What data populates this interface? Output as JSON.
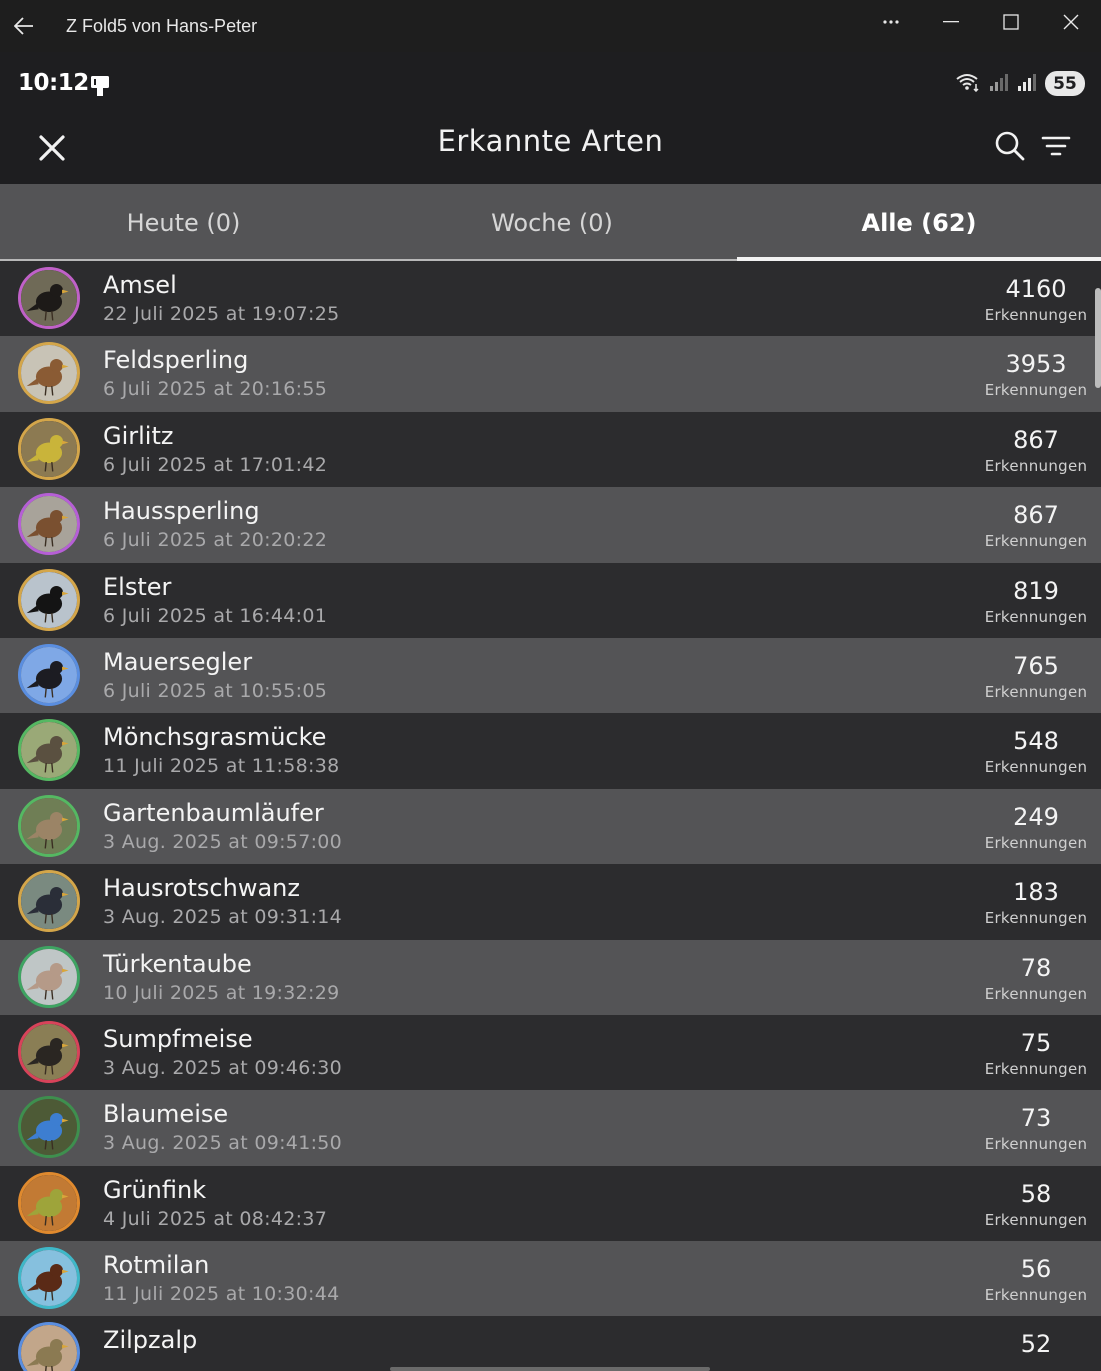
{
  "window": {
    "title": "Z Fold5 von Hans-Peter"
  },
  "status": {
    "time": "10:12",
    "battery": "55"
  },
  "appbar": {
    "title": "Erkannte Arten"
  },
  "tabs": [
    {
      "label": "Heute (0)"
    },
    {
      "label": "Woche (0)"
    },
    {
      "label": "Alle (62)"
    }
  ],
  "species": [
    {
      "name": "Amsel",
      "date": "22 Juli 2025 at 19:07:25",
      "count": "4160",
      "label": "Erkennungen",
      "ring": "#c061c8",
      "bg": "#6f6a57",
      "bird": "#1d1a18",
      "shade": "dark"
    },
    {
      "name": "Feldsperling",
      "date": "6 Juli 2025 at 20:16:55",
      "count": "3953",
      "label": "Erkennungen",
      "ring": "#d4a64a",
      "bg": "#c8c3b6",
      "bird": "#8a5b34",
      "shade": "light"
    },
    {
      "name": "Girlitz",
      "date": "6 Juli 2025 at 17:01:42",
      "count": "867",
      "label": "Erkennungen",
      "ring": "#d4a64a",
      "bg": "#8c7a52",
      "bird": "#c9b43a",
      "shade": "dark"
    },
    {
      "name": "Haussperling",
      "date": "6 Juli 2025 at 20:20:22",
      "count": "867",
      "label": "Erkennungen",
      "ring": "#b65fd6",
      "bg": "#a8a39a",
      "bird": "#7a5030",
      "shade": "light"
    },
    {
      "name": "Elster",
      "date": "6 Juli 2025 at 16:44:01",
      "count": "819",
      "label": "Erkennungen",
      "ring": "#d4a64a",
      "bg": "#b9c3cc",
      "bird": "#141414",
      "shade": "dark"
    },
    {
      "name": "Mauersegler",
      "date": "6 Juli 2025 at 10:55:05",
      "count": "765",
      "label": "Erkennungen",
      "ring": "#5a8ee0",
      "bg": "#7fa8e6",
      "bird": "#1c1c22",
      "shade": "light"
    },
    {
      "name": "Mönchsgrasmücke",
      "date": "11 Juli 2025 at 11:58:38",
      "count": "548",
      "label": "Erkennungen",
      "ring": "#55b862",
      "bg": "#9aa977",
      "bird": "#5a5040",
      "shade": "dark"
    },
    {
      "name": "Gartenbaumläufer",
      "date": "3 Aug. 2025 at 09:57:00",
      "count": "249",
      "label": "Erkennungen",
      "ring": "#55b862",
      "bg": "#6f7e55",
      "bird": "#9b8466",
      "shade": "light"
    },
    {
      "name": "Hausrotschwanz",
      "date": "3 Aug. 2025 at 09:31:14",
      "count": "183",
      "label": "Erkennungen",
      "ring": "#d4a64a",
      "bg": "#7a8a80",
      "bird": "#2a2e38",
      "shade": "dark"
    },
    {
      "name": "Türkentaube",
      "date": "10 Juli 2025 at 19:32:29",
      "count": "78",
      "label": "Erkennungen",
      "ring": "#3ea462",
      "bg": "#bfc6c6",
      "bird": "#b59a88",
      "shade": "light"
    },
    {
      "name": "Sumpfmeise",
      "date": "3 Aug. 2025 at 09:46:30",
      "count": "75",
      "label": "Erkennungen",
      "ring": "#d8435a",
      "bg": "#8a7e55",
      "bird": "#2a2622",
      "shade": "dark"
    },
    {
      "name": "Blaumeise",
      "date": "3 Aug. 2025 at 09:41:50",
      "count": "73",
      "label": "Erkennungen",
      "ring": "#3e8f4e",
      "bg": "#4d5a36",
      "bird": "#3d7ed1",
      "shade": "light"
    },
    {
      "name": "Grünfink",
      "date": "4 Juli 2025 at 08:42:37",
      "count": "58",
      "label": "Erkennungen",
      "ring": "#e08a2e",
      "bg": "#c27a34",
      "bird": "#9ea43a",
      "shade": "dark"
    },
    {
      "name": "Rotmilan",
      "date": "11 Juli 2025 at 10:30:44",
      "count": "56",
      "label": "Erkennungen",
      "ring": "#3fb8c8",
      "bg": "#86c0de",
      "bird": "#5a2a16",
      "shade": "light"
    },
    {
      "name": "Zilpzalp",
      "date": "",
      "count": "52",
      "label": "",
      "ring": "#5a8ee0",
      "bg": "#c2a68a",
      "bird": "#8b7a52",
      "shade": "dark"
    }
  ]
}
